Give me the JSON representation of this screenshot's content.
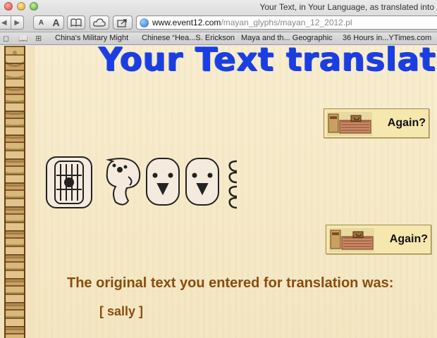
{
  "window": {
    "title": "Your Text, in Your Language, as translated into"
  },
  "toolbar": {
    "back_icon": "back-arrow-icon",
    "forward_icon": "forward-arrow-icon",
    "font_small_label": "A",
    "font_large_label": "A",
    "reader_icon": "open-book-icon",
    "cloud_icon": "cloud-icon",
    "share_icon": "share-icon"
  },
  "address": {
    "domain": "www.event12.com",
    "path": "/mayan_glyphs/mayan_12_2012.pl",
    "site_icon": "globe-icon"
  },
  "bookmarks": {
    "items": [
      "China's Military Might",
      "Chinese “Hea...S. Erickson",
      "Maya and th... Geographic",
      "36 Hours in...YTimes.com"
    ]
  },
  "page": {
    "heading": "Your Text translated",
    "again_label": "Again?",
    "original_label": "The original text you entered for translation was:",
    "entered_text": "[ sally ]",
    "colors": {
      "heading": "#1a3ee0",
      "original": "#8a4c0d",
      "background": "#f6e9c8"
    }
  }
}
